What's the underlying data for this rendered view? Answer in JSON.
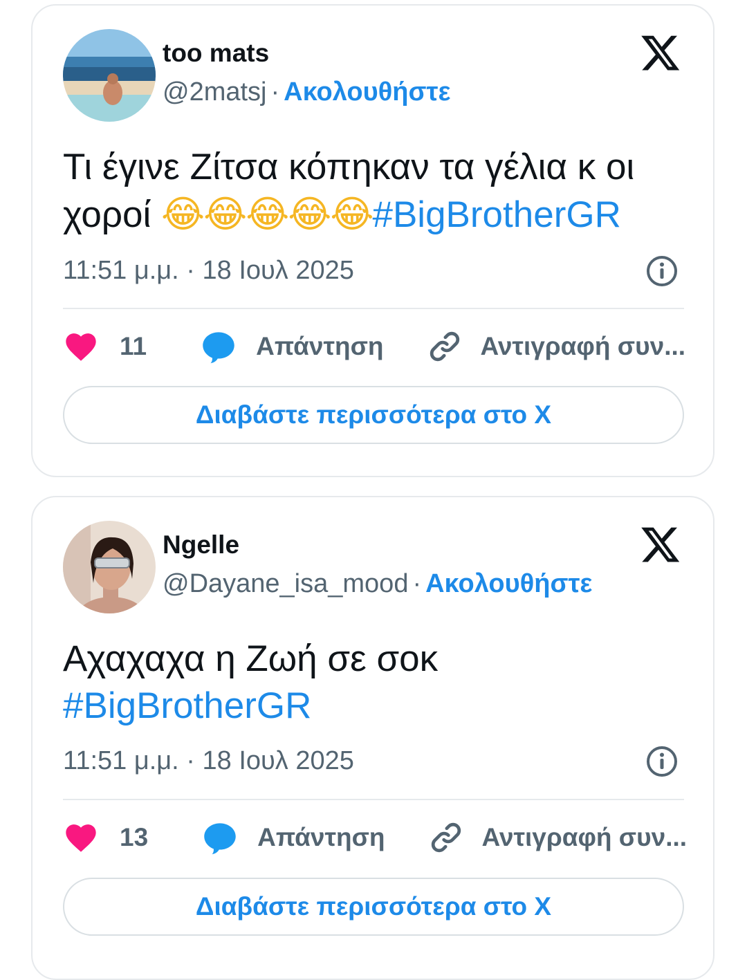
{
  "colors": {
    "accent": "#1d8ae8",
    "muted": "#536471",
    "heart": "#f91880",
    "reply_bubble": "#1d9bf0",
    "border": "#e6e9ec"
  },
  "tweets": [
    {
      "display_name": "too mats",
      "handle": "@2matsj",
      "separator": "·",
      "follow_label": "Ακολουθήστε",
      "text": "Τι έγινε Ζίτσα κόπηκαν τα γέλια κ οι χοροί ",
      "emojis": "😂😂😂😂😂",
      "hashtag": "#BigBrotherGR",
      "timestamp": "11:51 μ.μ. · 18 Ιουλ 2025",
      "like_count": "11",
      "reply_label": "Απάντηση",
      "copy_label": "Αντιγραφή συν...",
      "read_more_label": "Διαβάστε περισσότερα στο X",
      "avatar_icon": "beach-photo-avatar"
    },
    {
      "display_name": "Ngelle",
      "handle": "@Dayane_isa_mood",
      "separator": "·",
      "follow_label": "Ακολουθήστε",
      "text": "Αχαχαχα η Ζωή σε σοκ",
      "emojis": "",
      "hashtag": "#BigBrotherGR",
      "timestamp": "11:51 μ.μ. · 18 Ιουλ 2025",
      "like_count": "13",
      "reply_label": "Απάντηση",
      "copy_label": "Αντιγραφή συν...",
      "read_more_label": "Διαβάστε περισσότερα στο X",
      "avatar_icon": "person-photo-avatar"
    }
  ],
  "icons": {
    "logo": "x-logo-icon",
    "info": "info-icon",
    "like": "heart-icon",
    "reply": "speech-bubble-icon",
    "copy": "link-icon"
  }
}
